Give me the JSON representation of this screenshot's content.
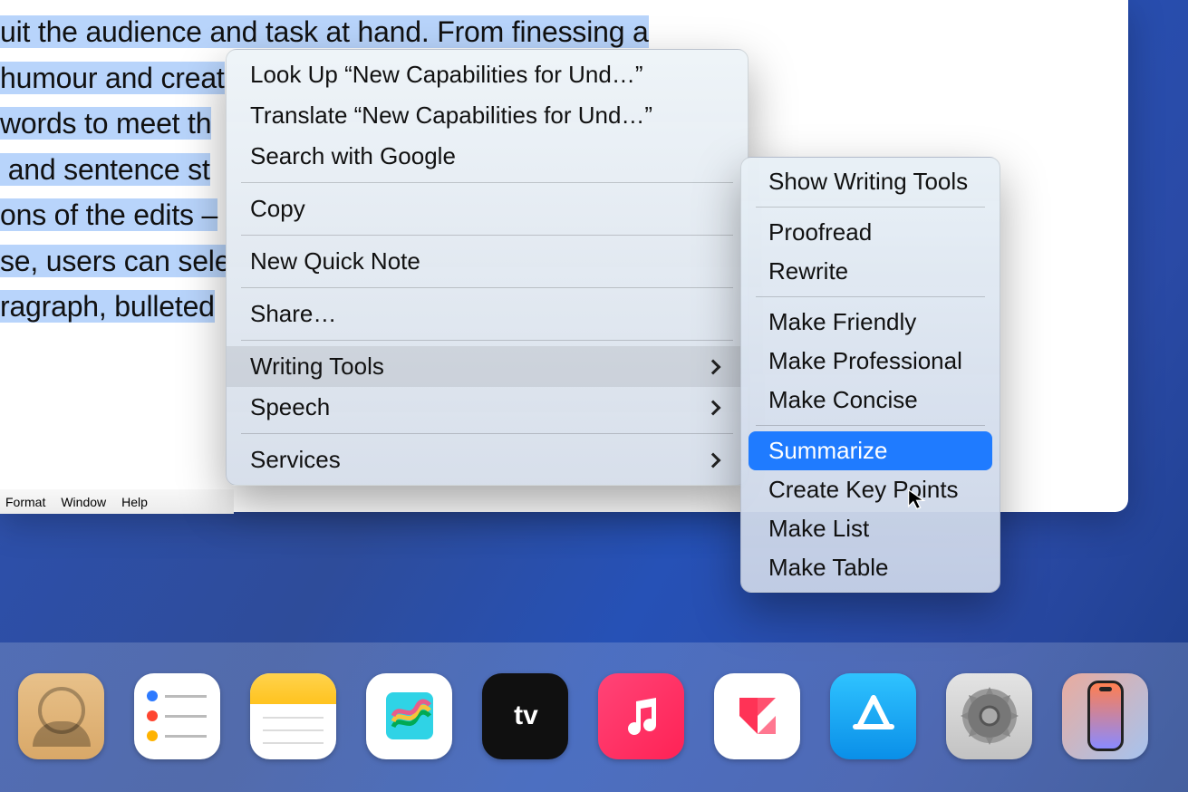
{
  "document": {
    "lines": [
      {
        "t": "uit the audience and task at hand. From finessing a",
        "sel": true
      },
      {
        "t": "humour and creat",
        "sel": true
      },
      {
        "t": "words to meet th",
        "sel": true
      },
      {
        "t": " and sentence st",
        "sel": true
      },
      {
        "t": "ons of the edits –",
        "sel": true
      },
      {
        "t": "se, users can sele",
        "sel": true
      },
      {
        "t": "ragraph, bulleted",
        "sel": true
      }
    ]
  },
  "menubar": {
    "items": [
      "Format",
      "Window",
      "Help"
    ]
  },
  "context_menu": {
    "groups": [
      [
        {
          "label": "Look Up “New Capabilities for Und…”",
          "submenu": false
        },
        {
          "label": "Translate “New Capabilities for Und…”",
          "submenu": false
        },
        {
          "label": "Search with Google",
          "submenu": false
        }
      ],
      [
        {
          "label": "Copy",
          "submenu": false
        }
      ],
      [
        {
          "label": "New Quick Note",
          "submenu": false
        }
      ],
      [
        {
          "label": "Share…",
          "submenu": false
        }
      ],
      [
        {
          "label": "Writing Tools",
          "submenu": true,
          "hovered": true
        },
        {
          "label": "Speech",
          "submenu": true
        }
      ],
      [
        {
          "label": "Services",
          "submenu": true
        }
      ]
    ]
  },
  "writing_tools_submenu": {
    "groups": [
      [
        {
          "label": "Show Writing Tools"
        }
      ],
      [
        {
          "label": "Proofread"
        },
        {
          "label": "Rewrite"
        }
      ],
      [
        {
          "label": "Make Friendly"
        },
        {
          "label": "Make Professional"
        },
        {
          "label": "Make Concise"
        }
      ],
      [
        {
          "label": "Summarize",
          "selected": true
        },
        {
          "label": "Create Key Points"
        },
        {
          "label": "Make List"
        },
        {
          "label": "Make Table"
        }
      ]
    ]
  },
  "dock": {
    "apps": [
      {
        "name": "contacts"
      },
      {
        "name": "reminders"
      },
      {
        "name": "notes"
      },
      {
        "name": "freeform"
      },
      {
        "name": "tv"
      },
      {
        "name": "music"
      },
      {
        "name": "news"
      },
      {
        "name": "appstore"
      },
      {
        "name": "settings"
      },
      {
        "name": "mirror"
      }
    ]
  }
}
